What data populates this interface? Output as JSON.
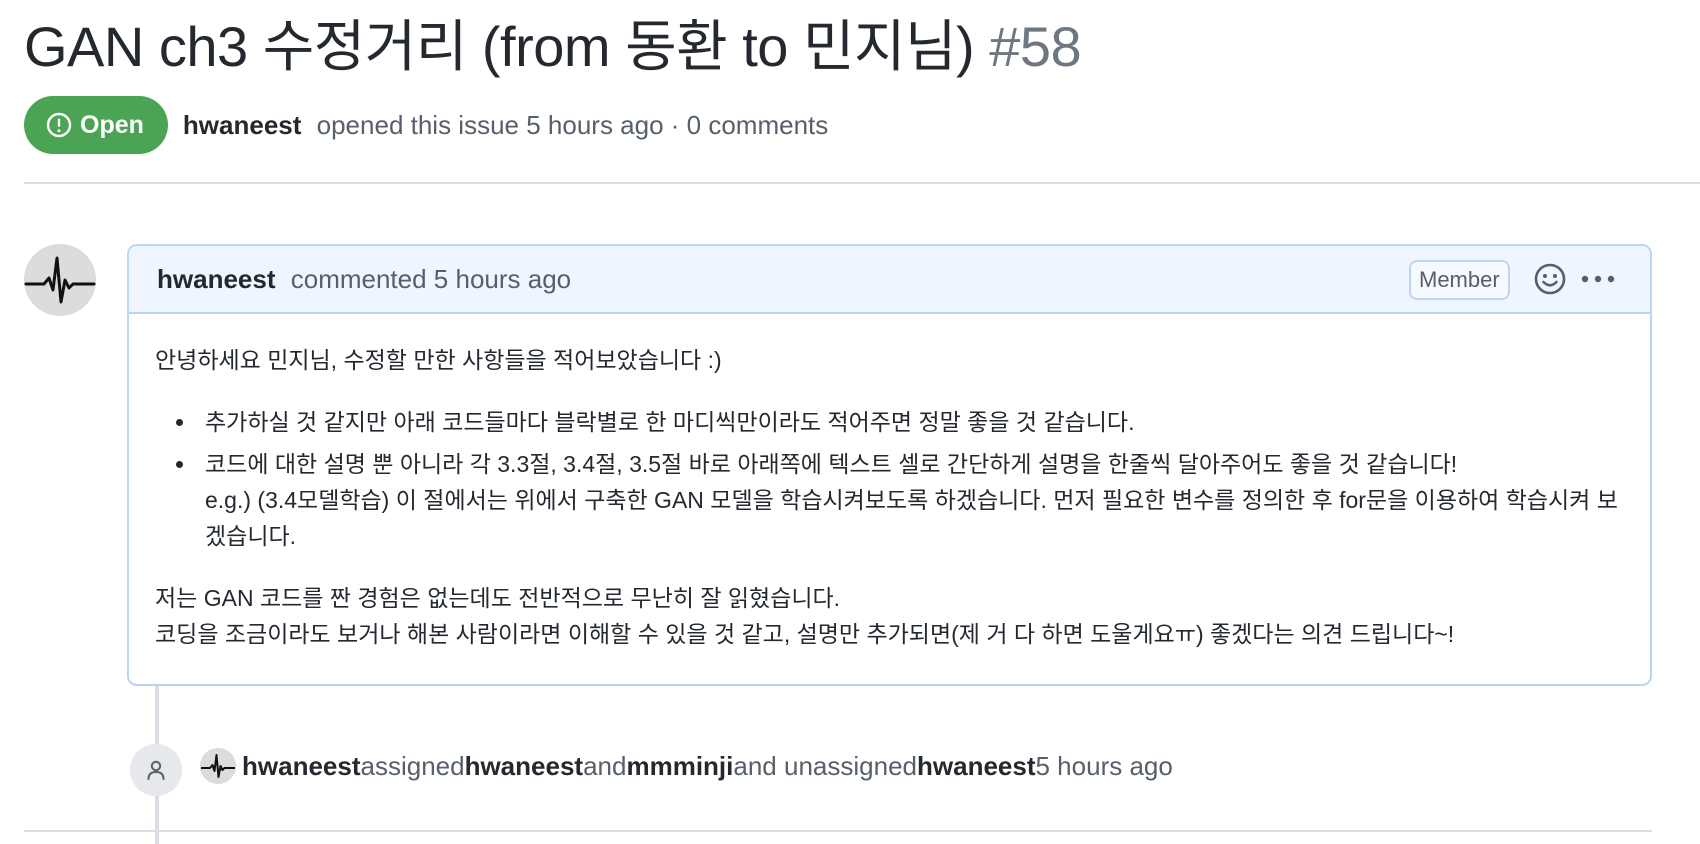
{
  "issue": {
    "title": "GAN ch3 수정거리 (from 동환 to 민지님)",
    "number": "#58",
    "state": "Open",
    "author": "hwaneest",
    "meta": "opened this issue 5 hours ago · 0 comments"
  },
  "comment": {
    "author": "hwaneest",
    "action": "commented 5 hours ago",
    "role_badge": "Member",
    "intro": "안녕하세요 민지님, 수정할 만한 사항들을 적어보았습니다 :)",
    "bullets": [
      "추가하실 것 같지만 아래 코드들마다 블락별로 한 마디씩만이라도 적어주면 정말 좋을 것 같습니다.",
      "코드에 대한 설명 뿐 아니라 각 3.3절, 3.4절, 3.5절 바로 아래쪽에 텍스트 셀로 간단하게 설명을 한줄씩 달아주어도 좋을 것 같습니다!"
    ],
    "bullet2_example": "e.g.) (3.4모델학습) 이 절에서는 위에서 구축한 GAN 모델을 학습시켜보도록 하겠습니다. 먼저 필요한 변수를 정의한 후 for문을 이용하여 학습시켜 보겠습니다.",
    "closing_line1": "저는 GAN 코드를 짠 경험은 없는데도 전반적으로 무난히 잘 읽혔습니다.",
    "closing_line2": "코딩을 조금이라도 보거나 해본 사람이라면 이해할 수 있을 것 같고, 설명만 추가되면(제 거 다 하면 도울게요ㅠ) 좋겠다는 의견 드립니다~!"
  },
  "event": {
    "actor": "hwaneest",
    "verb1": "assigned",
    "assignee1": "hwaneest",
    "and": "and",
    "assignee2": "mmminji",
    "verb2": "and unassigned",
    "unassignee": "hwaneest",
    "time": "5 hours ago"
  },
  "icons": {
    "state": "issue-opened-icon",
    "reaction": "smiley-icon",
    "more": "kebab-horizontal-icon",
    "event": "person-icon"
  },
  "colors": {
    "open_green": "#4aa454",
    "comment_header_bg": "#f0f6ff",
    "comment_border": "#bcd5f0"
  }
}
